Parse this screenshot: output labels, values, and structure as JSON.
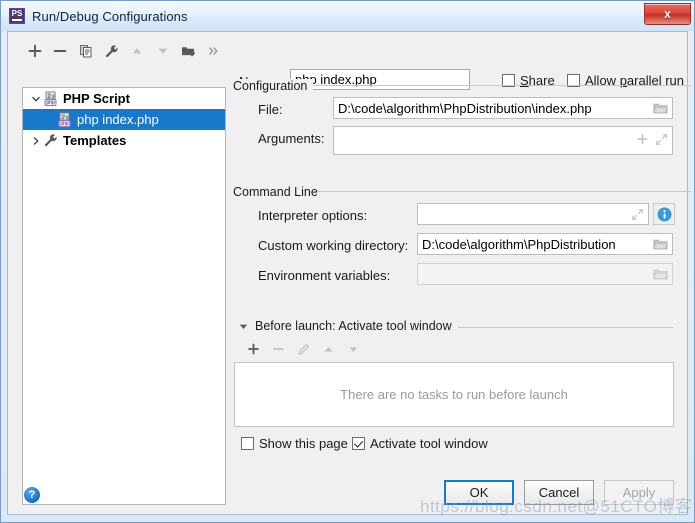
{
  "window": {
    "title": "Run/Debug Configurations",
    "app_icon": "phpstorm-icon",
    "app_icon_label": "PS",
    "close_label": "x"
  },
  "toolbar": {
    "items": [
      {
        "name": "add-configuration-button",
        "icon": "plus-icon",
        "enabled": true
      },
      {
        "name": "remove-configuration-button",
        "icon": "minus-icon",
        "enabled": true
      },
      {
        "name": "copy-configuration-button",
        "icon": "copy-icon",
        "enabled": true
      },
      {
        "name": "edit-templates-button",
        "icon": "wrench-icon",
        "enabled": true
      },
      {
        "name": "move-up-button",
        "icon": "arrow-up-icon",
        "enabled": false
      },
      {
        "name": "move-down-button",
        "icon": "arrow-down-icon",
        "enabled": false
      },
      {
        "name": "move-into-folder-button",
        "icon": "folder-add-icon",
        "enabled": true
      },
      {
        "name": "more-actions-button",
        "icon": "chevron-double-right-icon",
        "enabled": true
      }
    ]
  },
  "name_row": {
    "label": "Name:",
    "value": "php index.php",
    "placeholder": "",
    "share": {
      "label": "Share",
      "mnemonic": "S",
      "checked": false
    },
    "parallel": {
      "label": "Allow parallel run",
      "mnemonic": "p",
      "checked": false
    }
  },
  "tree": {
    "nodes": [
      {
        "label": "PHP Script",
        "icon": "php-file-icon",
        "twisty": "chevron-down-icon",
        "depth": 0,
        "bold": true,
        "selected": false
      },
      {
        "label": "php index.php",
        "icon": "php-file-icon",
        "twisty": "",
        "depth": 1,
        "bold": false,
        "selected": true
      },
      {
        "label": "Templates",
        "icon": "wrench-icon",
        "twisty": "chevron-right-icon",
        "depth": 0,
        "bold": true,
        "selected": false
      }
    ]
  },
  "configuration": {
    "title": "Configuration",
    "file": {
      "label": "File:",
      "value": "D:\\code\\algorithm\\PhpDistribution\\index.php",
      "browse_icon": "folder-open-icon"
    },
    "arguments": {
      "label": "Arguments:",
      "value": "",
      "add_icon": "plus-icon",
      "expand_icon": "expand-diagonal-icon"
    }
  },
  "command_line": {
    "title": "Command Line",
    "interpreter_options": {
      "label": "Interpreter options:",
      "value": "",
      "expand_icon": "expand-diagonal-icon",
      "info_icon": "info-icon"
    },
    "working_directory": {
      "label": "Custom working directory:",
      "value": "D:\\code\\algorithm\\PhpDistribution",
      "browse_icon": "folder-open-icon"
    },
    "environment_variables": {
      "label": "Environment variables:",
      "value": "",
      "browse_icon": "folder-open-icon",
      "disabled": true
    }
  },
  "before_launch": {
    "title": "Before launch: Activate tool window",
    "twisty": "triangle-down-icon",
    "toolbar": [
      {
        "name": "add-task-button",
        "icon": "plus-icon",
        "enabled": true
      },
      {
        "name": "remove-task-button",
        "icon": "minus-icon",
        "enabled": false
      },
      {
        "name": "edit-task-button",
        "icon": "pencil-icon",
        "enabled": false
      },
      {
        "name": "move-task-up-button",
        "icon": "arrow-up-icon",
        "enabled": false
      },
      {
        "name": "move-task-down-button",
        "icon": "arrow-down-icon",
        "enabled": false
      }
    ],
    "empty_text": "There are no tasks to run before launch",
    "show_this_page": {
      "label": "Show this page",
      "checked": false
    },
    "activate_tool_window": {
      "label": "Activate tool window",
      "checked": true
    }
  },
  "footer": {
    "help": "?",
    "ok": "OK",
    "cancel": "Cancel",
    "apply": "Apply",
    "apply_enabled": false
  },
  "watermark": "https://blog.csdn.net@51CTO博客",
  "colors": {
    "selection": "#1978c8",
    "accent": "#1978c8",
    "close": "#d8433a"
  }
}
